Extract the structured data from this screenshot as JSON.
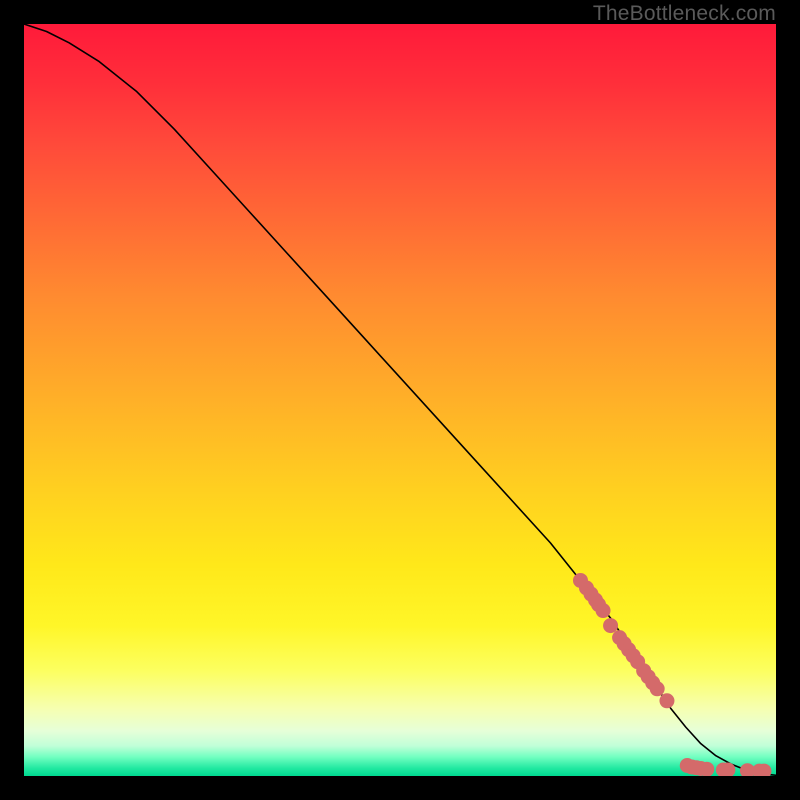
{
  "watermark": "TheBottleneck.com",
  "chart_data": {
    "type": "line",
    "title": "",
    "xlabel": "",
    "ylabel": "",
    "xlim": [
      0,
      100
    ],
    "ylim": [
      0,
      100
    ],
    "curve": {
      "name": "curve",
      "x": [
        0,
        3,
        6,
        10,
        15,
        20,
        25,
        30,
        35,
        40,
        45,
        50,
        55,
        60,
        65,
        70,
        74,
        78,
        81,
        84,
        86,
        88,
        90,
        92,
        94,
        96,
        98,
        100
      ],
      "y": [
        100,
        99,
        97.5,
        95,
        91,
        86,
        80.5,
        75,
        69.5,
        64,
        58.5,
        53,
        47.5,
        42,
        36.5,
        31,
        26,
        21,
        16.5,
        12,
        9,
        6.5,
        4.3,
        2.7,
        1.6,
        0.8,
        0.3,
        0.1
      ]
    },
    "points": {
      "name": "points",
      "color": "#d46a6a",
      "x": [
        74,
        74.8,
        75.4,
        76,
        76.4,
        77,
        78,
        79.2,
        79.8,
        80.4,
        81.0,
        81.6,
        82.4,
        83.0,
        83.6,
        84.2,
        85.5,
        88.2,
        88.8,
        89.4,
        90.0,
        90.8,
        93.0,
        93.6,
        96.2,
        97.8,
        98.4
      ],
      "y": [
        26.0,
        25.0,
        24.2,
        23.4,
        22.8,
        22.0,
        20.0,
        18.4,
        17.6,
        16.8,
        16.0,
        15.2,
        14.0,
        13.2,
        12.4,
        11.6,
        10.0,
        1.4,
        1.2,
        1.1,
        1.0,
        0.9,
        0.8,
        0.8,
        0.7,
        0.65,
        0.65
      ]
    }
  }
}
